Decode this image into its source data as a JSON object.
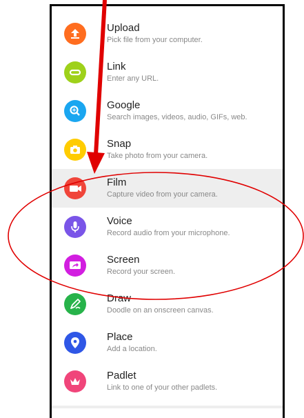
{
  "menu": {
    "items": [
      {
        "title": "Upload",
        "subtitle": "Pick file from your computer.",
        "color": "#ff6d1f",
        "icon": "upload-icon"
      },
      {
        "title": "Link",
        "subtitle": "Enter any URL.",
        "color": "#9ed11a",
        "icon": "link-icon"
      },
      {
        "title": "Google",
        "subtitle": "Search images, videos, audio, GIFs, web.",
        "color": "#1aa6f0",
        "icon": "google-search-icon"
      },
      {
        "title": "Snap",
        "subtitle": "Take photo from your camera.",
        "color": "#ffcc00",
        "icon": "camera-icon"
      },
      {
        "title": "Film",
        "subtitle": "Capture video from your camera.",
        "color": "#f0453a",
        "icon": "video-camera-icon"
      },
      {
        "title": "Voice",
        "subtitle": "Record audio from your microphone.",
        "color": "#7a55e8",
        "icon": "microphone-icon"
      },
      {
        "title": "Screen",
        "subtitle": "Record your screen.",
        "color": "#d21ee0",
        "icon": "screen-share-icon"
      },
      {
        "title": "Draw",
        "subtitle": "Doodle on an onscreen canvas.",
        "color": "#27b34a",
        "icon": "draw-icon"
      },
      {
        "title": "Place",
        "subtitle": "Add a location.",
        "color": "#2f57e6",
        "icon": "location-pin-icon"
      },
      {
        "title": "Padlet",
        "subtitle": "Link to one of your other padlets.",
        "color": "#f0457a",
        "icon": "padlet-icon"
      }
    ]
  },
  "annotation": {
    "color": "#e00000",
    "arrow": "red-arrow",
    "ellipse": "red-ellipse"
  }
}
